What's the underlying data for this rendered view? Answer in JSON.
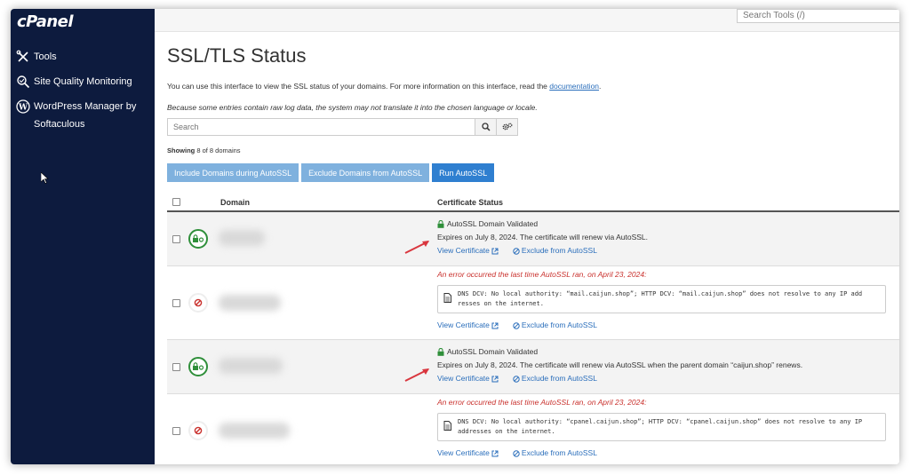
{
  "sidebar": {
    "logo": "cPanel",
    "items": [
      {
        "label": "Tools",
        "icon": "tools-icon"
      },
      {
        "label": "Site Quality Monitoring",
        "icon": "site-quality-icon"
      },
      {
        "label": "WordPress Manager by Softaculous",
        "icon": "wordpress-icon"
      }
    ]
  },
  "topbar": {
    "search_placeholder": "Search Tools (/)"
  },
  "page": {
    "title": "SSL/TLS Status",
    "intro_text": "You can use this interface to view the SSL status of your domains. For more information on this interface, read the ",
    "intro_link": "documentation",
    "intro_end": ".",
    "note": "Because some entries contain raw log data, the system may not translate it into the chosen language or locale.",
    "search_placeholder": "Search",
    "showing_label": "Showing",
    "showing_text": " 8 of 8 domains"
  },
  "actions": {
    "include": "Include Domains during AutoSSL",
    "exclude": "Exclude Domains from AutoSSL",
    "run": "Run AutoSSL"
  },
  "table": {
    "col_domain": "Domain",
    "col_status": "Certificate Status",
    "view_certificate": "View Certificate",
    "exclude_link": "Exclude from AutoSSL",
    "rows": [
      {
        "type": "valid",
        "status_label": "AutoSSL Domain Validated",
        "expires": "Expires on July 8, 2024. The certificate will renew via AutoSSL."
      },
      {
        "type": "error",
        "error_title": "An error occurred the last time AutoSSL ran, on April 23, 2024:",
        "error_line1": "DNS DCV: No local authority: “mail.caijun.shop”; HTTP DCV: “mail.caijun.shop” does not resolve to any IP add",
        "error_line2": "resses on the internet."
      },
      {
        "type": "valid",
        "status_label": "AutoSSL Domain Validated",
        "expires": "Expires on July 8, 2024. The certificate will renew via AutoSSL when the parent domain “caijun.shop” renews."
      },
      {
        "type": "error",
        "error_title": "An error occurred the last time AutoSSL ran, on April 23, 2024:",
        "error_line1": "DNS DCV: No local authority: “cpanel.caijun.shop”; HTTP DCV: “cpanel.caijun.shop” does not resolve to any IP",
        "error_line2": "addresses on the internet."
      }
    ]
  },
  "colors": {
    "sidebar_bg": "#0d1b3e",
    "primary": "#2f7fd0",
    "success": "#2f8f3a",
    "error": "#c9302c",
    "annotation_arrow": "#d9363e"
  }
}
